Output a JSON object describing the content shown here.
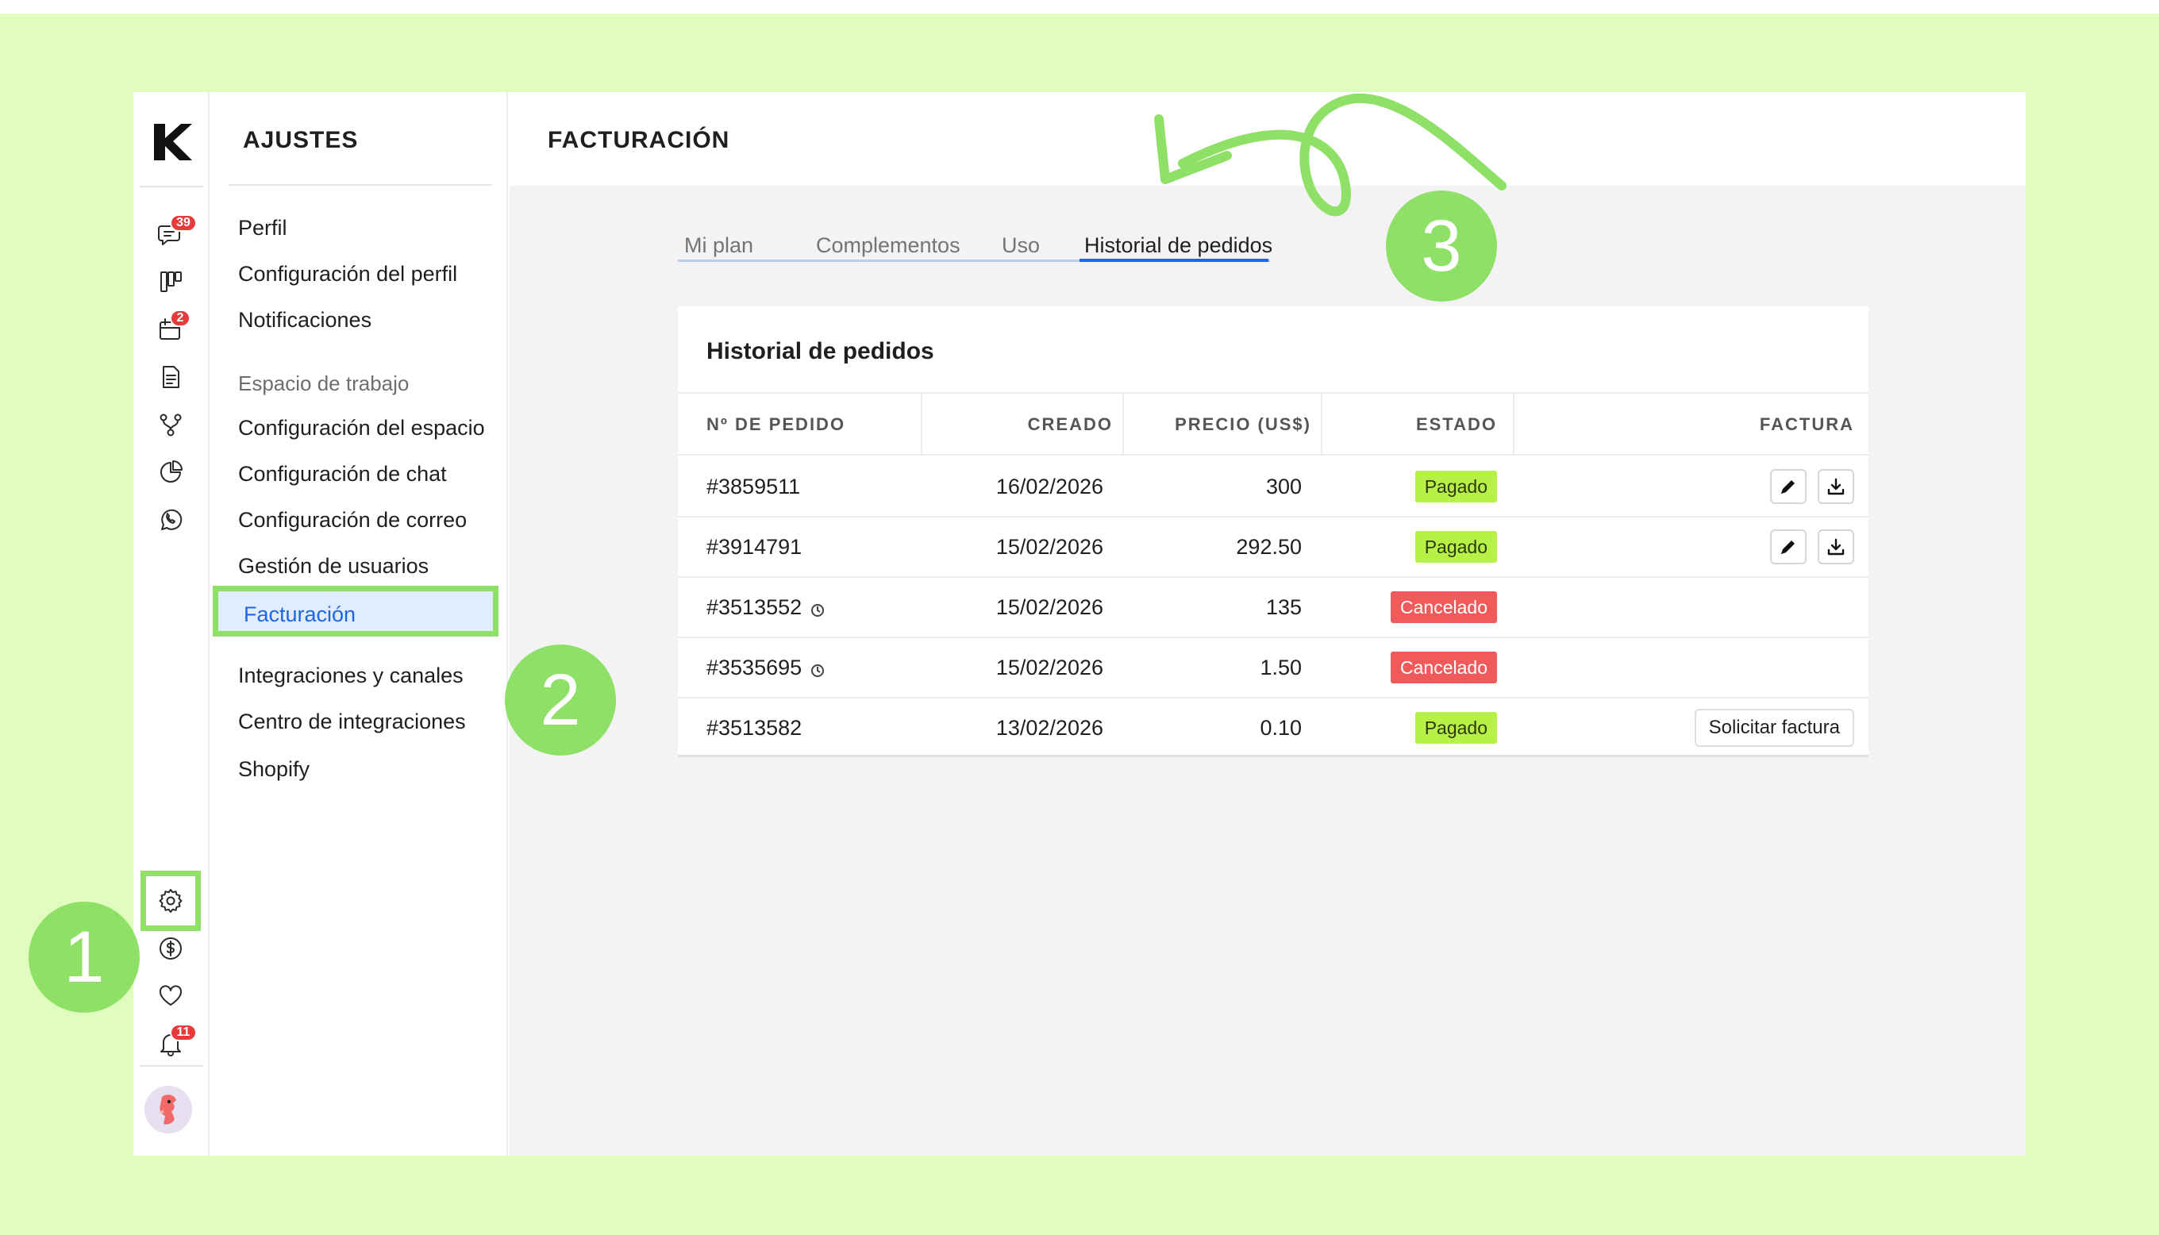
{
  "rail": {
    "badges": {
      "chat": "39",
      "calendar": "2",
      "notifications": "11"
    }
  },
  "settings": {
    "title": "AJUSTES",
    "items": [
      {
        "label": "Perfil"
      },
      {
        "label": "Configuración del perfil"
      },
      {
        "label": "Notificaciones"
      },
      {
        "label": "Espacio de trabajo"
      },
      {
        "label": "Configuración del espacio"
      },
      {
        "label": "Configuración de chat"
      },
      {
        "label": "Configuración de correo"
      },
      {
        "label": "Gestión de usuarios"
      },
      {
        "label": "Facturación"
      },
      {
        "label": "Integraciones y canales"
      },
      {
        "label": "Centro de integraciones"
      },
      {
        "label": "Shopify"
      }
    ]
  },
  "main": {
    "title": "FACTURACIÓN",
    "tabs": [
      {
        "label": "Mi plan"
      },
      {
        "label": "Complementos"
      },
      {
        "label": "Uso"
      },
      {
        "label": "Historial de pedidos"
      }
    ]
  },
  "orders": {
    "title": "Historial de pedidos",
    "columns": [
      "Nº DE PEDIDO",
      "CREADO",
      "PRECIO (US$)",
      "ESTADO",
      "FACTURA"
    ],
    "rows": [
      {
        "id": "#3859511",
        "created": "16/02/2026",
        "price": "300",
        "status": "Pagado"
      },
      {
        "id": "#3914791",
        "created": "15/02/2026",
        "price": "292.50",
        "status": "Pagado"
      },
      {
        "id": "#3513552",
        "created": "15/02/2026",
        "price": "135",
        "status": "Cancelado"
      },
      {
        "id": "#3535695",
        "created": "15/02/2026",
        "price": "1.50",
        "status": "Cancelado"
      },
      {
        "id": "#3513582",
        "created": "13/02/2026",
        "price": "0.10",
        "status": "Pagado",
        "invoice_action": "Solicitar factura"
      }
    ]
  },
  "callouts": [
    "1",
    "2",
    "3"
  ],
  "colors": {
    "background": "#e0fcbf",
    "highlight": "#8ee066",
    "accent": "#1f66e6",
    "paid": "#b7f046",
    "cancelled": "#f05a5a",
    "badge": "#e53b3b"
  }
}
